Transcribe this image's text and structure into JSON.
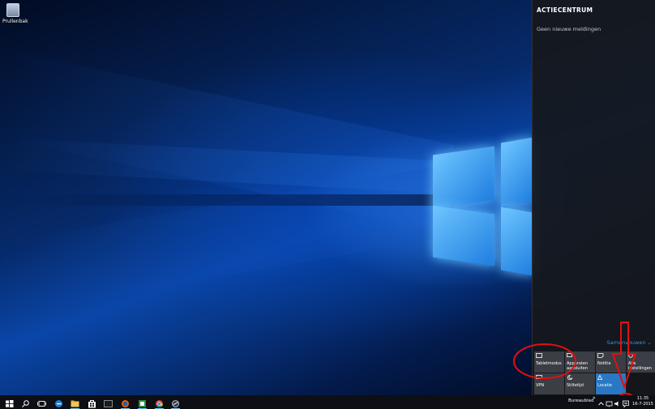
{
  "desktop": {
    "recycle_bin_label": "Prullenbak"
  },
  "action_center": {
    "title": "ACTIECENTRUM",
    "empty_message": "Geen nieuwe meldingen",
    "collapse_label": "Samenvouwen",
    "accent_color": "#2a78c3",
    "tiles": [
      {
        "label": "Tabletmodus",
        "icon": "tablet-mode-icon",
        "active": false
      },
      {
        "label": "Apparaten aansluiten",
        "icon": "connect-icon",
        "active": false
      },
      {
        "label": "Notitie",
        "icon": "note-icon",
        "active": false
      },
      {
        "label": "Alle instellingen",
        "icon": "gear-icon",
        "active": false
      },
      {
        "label": "VPN",
        "icon": "vpn-icon",
        "active": false
      },
      {
        "label": "Stiltetijd",
        "icon": "moon-icon",
        "active": false
      },
      {
        "label": "Locatie",
        "icon": "location-icon",
        "active": true
      }
    ]
  },
  "taskbar": {
    "icons": [
      "start-icon",
      "search-icon",
      "task-view-icon",
      "edge-icon",
      "file-explorer-icon",
      "store-icon",
      "terminal-icon",
      "firefox-icon",
      "spreadsheet-icon",
      "chrome-icon",
      "app-icon"
    ],
    "desktop_label": "Bureaublad",
    "desktop_chevron": "»",
    "time": "11:35",
    "date": "16-7-2015"
  },
  "annotations": {
    "highlight_color": "#e01010"
  }
}
